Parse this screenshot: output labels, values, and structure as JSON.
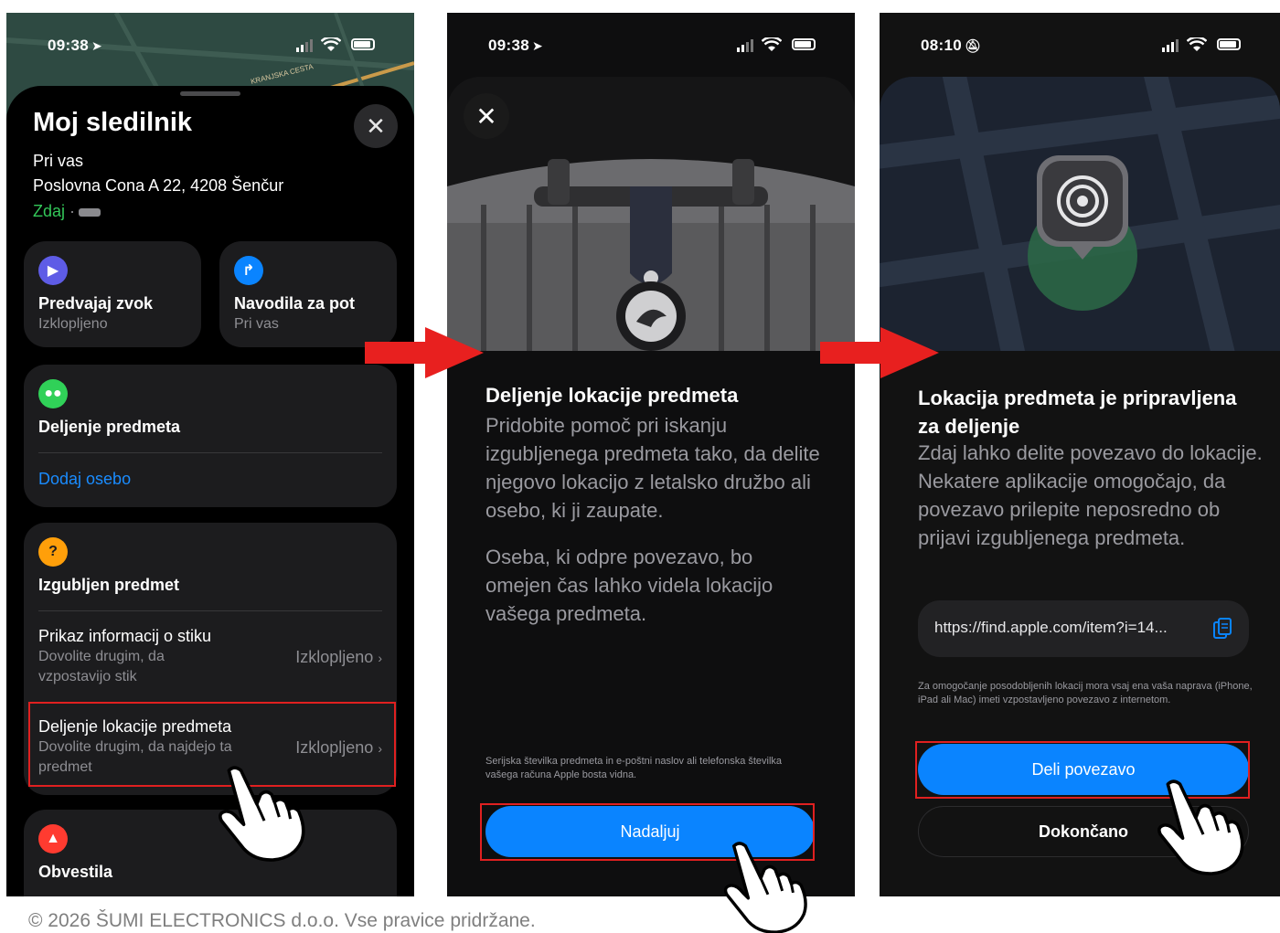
{
  "panel1": {
    "status_time": "09:38",
    "title": "Moj sledilnik",
    "location_heading": "Pri vas",
    "address": "Poslovna Cona A 22, 4208 Šenčur",
    "now_label": "Zdaj",
    "now_sep": "·",
    "play_sound": {
      "title": "Predvajaj zvok",
      "sub": "Izklopljeno"
    },
    "directions": {
      "title": "Navodila za pot",
      "sub": "Pri vas"
    },
    "share_item": {
      "title": "Deljenje predmeta",
      "add_person": "Dodaj osebo"
    },
    "lost_item": {
      "title": "Izgubljen predmet",
      "contact_info": {
        "label": "Prikaz informacij o stiku",
        "desc": "Dovolite drugim, da vzpostavijo stik",
        "value": "Izklopljeno"
      },
      "share_location": {
        "label": "Deljenje lokacije predmeta",
        "desc": "Dovolite drugim, da najdejo ta predmet",
        "value": "Izklopljeno"
      }
    },
    "notifications": {
      "title": "Obvestila"
    },
    "map_street": "KRANJSKA CESTA"
  },
  "panel2": {
    "status_time": "09:38",
    "title": "Deljenje lokacije predmeta",
    "body1": "Pridobite pomoč pri iskanju izgubljenega predmeta tako, da delite njegovo lokacijo z letalsko družbo ali osebo, ki ji zaupate.",
    "body2": "Oseba, ki odpre povezavo, bo omejen čas lahko videla lokacijo vašega predmeta.",
    "note": "Serijska številka predmeta in e-poštni naslov ali telefonska številka vašega računa Apple bosta vidna.",
    "button": "Nadaljuj"
  },
  "panel3": {
    "status_time": "08:10",
    "title": "Lokacija predmeta je pripravljena za deljenje",
    "body": "Zdaj lahko delite povezavo do lokacije. Nekatere aplikacije omogočajo, da povezavo prilepite neposredno ob prijavi izgubljenega predmeta.",
    "url": "https://find.apple.com/item?i=14...",
    "note": "Za omogočanje posodobljenih lokacij mora vsaj ena vaša naprava (iPhone, iPad ali Mac) imeti vzpostavljeno povezavo z internetom.",
    "share_button": "Deli povezavo",
    "done_button": "Dokončano"
  },
  "footer": {
    "copyright": "© 2026 ŠUMI ELECTRONICS d.o.o. Vse pravice pridržane."
  },
  "colors": {
    "accent_blue": "#0a84ff",
    "highlight_red": "#e02020",
    "green": "#33c759",
    "orange": "#ff9f0a",
    "red_icon": "#ff3b30",
    "arrow_red": "#e8201f"
  },
  "icons": [
    "location-arrow-icon",
    "cellular-icon",
    "wifi-icon",
    "battery-icon",
    "close-icon",
    "play-icon",
    "directions-icon",
    "people-icon",
    "question-icon",
    "bell-icon",
    "chevron-right-icon",
    "copy-icon",
    "airtag-icon",
    "radar-icon",
    "silent-bell-icon",
    "hand-pointer-icon"
  ]
}
